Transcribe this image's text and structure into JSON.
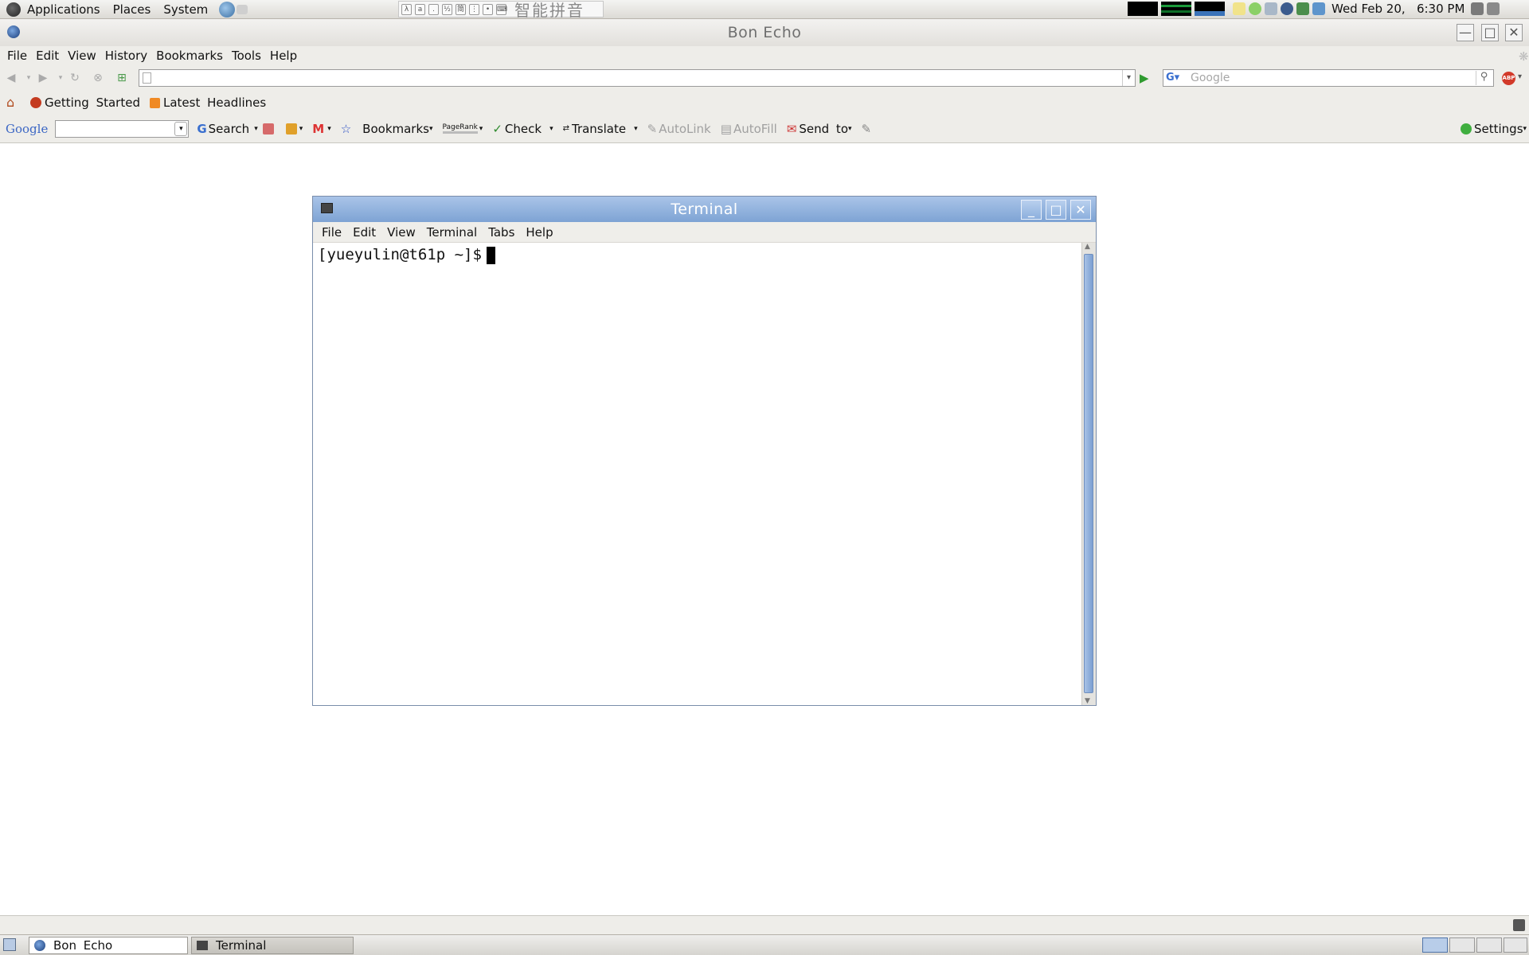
{
  "top_panel": {
    "menus": [
      "Applications",
      "Places",
      "System"
    ],
    "ime_text": "智能拼音",
    "clock": "Wed Feb 20,   6:30 PM"
  },
  "browser": {
    "title": "Bon Echo",
    "menus": [
      "File",
      "Edit",
      "View",
      "History",
      "Bookmarks",
      "Tools",
      "Help"
    ],
    "url": "",
    "search_placeholder": "Google",
    "bookmarks": [
      "Getting Started",
      "Latest Headlines"
    ],
    "google_toolbar": {
      "logo": "Google",
      "search_label": "Search",
      "bookmarks_label": "Bookmarks",
      "pagerank_label": "PageRank",
      "check_label": "Check",
      "translate_label": "Translate",
      "autolink_label": "AutoLink",
      "autofill_label": "AutoFill",
      "sendto_label": "Send to",
      "settings_label": "Settings"
    }
  },
  "terminal": {
    "title": "Terminal",
    "menus": [
      "File",
      "Edit",
      "View",
      "Terminal",
      "Tabs",
      "Help"
    ],
    "prompt": "[yueyulin@t61p ~]$"
  },
  "taskbar": {
    "tasks": [
      "Bon Echo",
      "Terminal"
    ]
  },
  "colors": {
    "terminal_titlebar": "#7ea3d4",
    "panel_bg": "#e4e2dd"
  }
}
